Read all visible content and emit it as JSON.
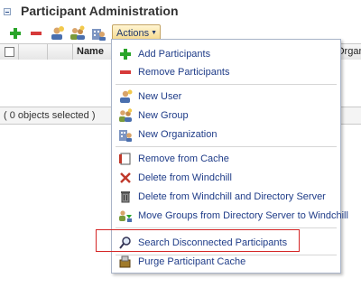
{
  "page": {
    "title": "Participant Administration"
  },
  "toolbar": {
    "buttons": [
      {
        "name": "add-icon"
      },
      {
        "name": "remove-icon"
      },
      {
        "name": "new-user-icon"
      },
      {
        "name": "new-group-icon"
      },
      {
        "name": "new-organization-icon"
      }
    ],
    "actions_label": "Actions",
    "actions_caret": "▼"
  },
  "table": {
    "columns": [
      "Name",
      "Organi"
    ],
    "selection_status": "( 0 objects selected )"
  },
  "menu": {
    "items": [
      {
        "label": "Add Participants",
        "icon": "add-icon"
      },
      {
        "label": "Remove Participants",
        "icon": "remove-icon"
      },
      {
        "label": "New User",
        "icon": "new-user-icon"
      },
      {
        "label": "New Group",
        "icon": "new-group-icon"
      },
      {
        "label": "New Organization",
        "icon": "new-organization-icon"
      },
      {
        "label": "Remove from Cache",
        "icon": "remove-cache-icon"
      },
      {
        "label": "Delete from Windchill",
        "icon": "delete-x-icon"
      },
      {
        "label": "Delete from Windchill and Directory Server",
        "icon": "trash-icon"
      },
      {
        "label": "Move Groups from Directory Server to Windchill",
        "icon": "move-groups-icon"
      },
      {
        "label": "Search Disconnected Participants",
        "icon": "search-icon"
      },
      {
        "label": "Purge Participant Cache",
        "icon": "purge-cache-icon"
      }
    ]
  },
  "colors": {
    "accent_red": "#d42424",
    "link_blue": "#1f3c88",
    "add_green": "#2aa52a",
    "remove_red": "#d63a3a"
  }
}
